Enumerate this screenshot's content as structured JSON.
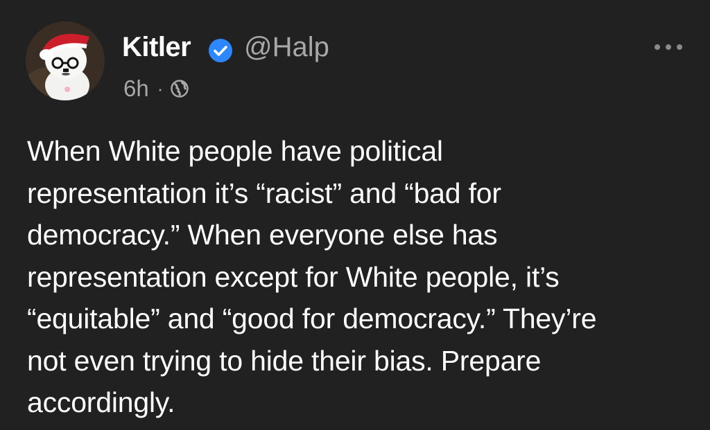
{
  "post": {
    "author": {
      "name": "Kitler",
      "handle": "@Halp",
      "verified": true,
      "avatar": "avatar-photo"
    },
    "time": "6h",
    "separator": "·",
    "audience_icon": "globe-icon",
    "menu_icon": "more-options-icon",
    "text": "When White people have political\nrepresentation it’s “racist” and “bad for\ndemocracy.” When everyone else has\nrepresentation except for White people, it’s\n“equitable” and “good for democracy.” They’re\nnot even trying to hide their bias. Prepare\naccordingly."
  },
  "colors": {
    "background": "#212121",
    "primary_text": "#ffffff",
    "secondary_text": "#a8a8a8",
    "verified_badge": "#2d88ff"
  }
}
